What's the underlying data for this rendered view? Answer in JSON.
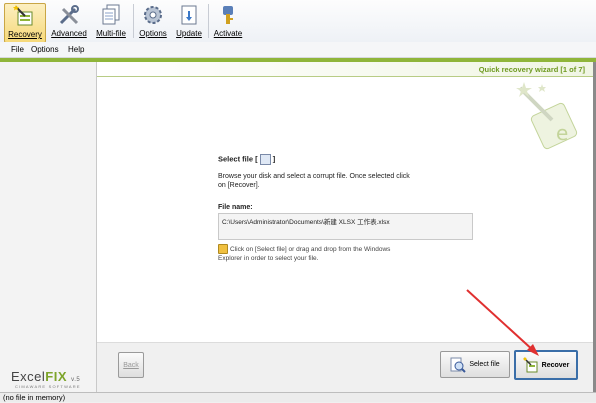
{
  "toolbar": {
    "buttons": [
      {
        "label": "Recovery",
        "icon": "recovery-wand-icon"
      },
      {
        "label": "Advanced",
        "icon": "tools-icon"
      },
      {
        "label": "Multi-file",
        "icon": "multi-file-icon"
      },
      {
        "label": "Options",
        "icon": "gear-icon"
      },
      {
        "label": "Update",
        "icon": "update-icon"
      },
      {
        "label": "Activate",
        "icon": "key-icon"
      }
    ]
  },
  "menu": {
    "items": [
      "File",
      "Options",
      "Help"
    ]
  },
  "wizard": {
    "title": "Quick recovery wizard [1 of 7]",
    "select_file_heading": "Select file [",
    "select_file_heading_end": "]",
    "description_line1": "Browse your disk and select a corrupt file. Once selected click",
    "description_line2": "on [Recover].",
    "file_name_label": "File name:",
    "file_name_value": "C:\\Users\\Administrator\\Documents\\新建 XLSX 工作表.xlsx",
    "hint_line1": "Click on [Select file] or drag and drop from the Windows",
    "hint_line2": "Explorer in order to select your file."
  },
  "buttons": {
    "back": "Back",
    "select_file": "Select file",
    "recover": "Recover"
  },
  "logo": {
    "text_a": "Excel",
    "text_b": "FIX",
    "version": "v.5",
    "sub": "CIMAWARE SOFTWARE"
  },
  "status": {
    "text": "(no file in memory)"
  },
  "colors": {
    "accent_green": "#8fb53a",
    "arrow_red": "#e03030"
  }
}
